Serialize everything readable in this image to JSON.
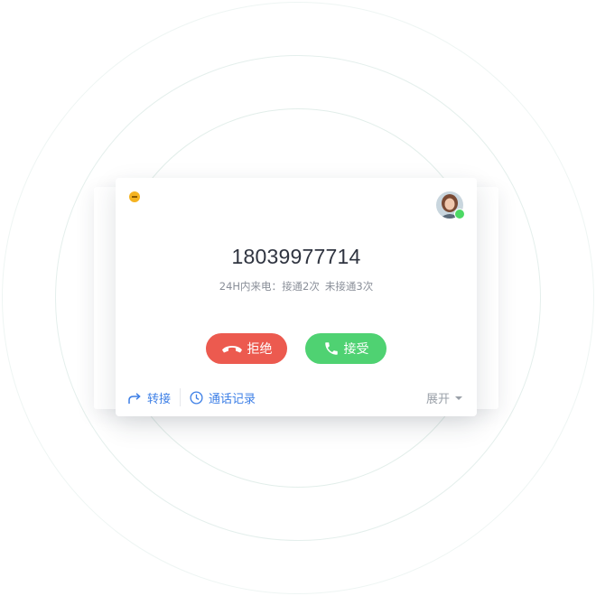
{
  "caller": {
    "number": "18039977714",
    "stats_prefix": "24H内来电：",
    "answered": "接通2次",
    "missed": "未接通3次"
  },
  "actions": {
    "reject_label": "拒绝",
    "accept_label": "接受"
  },
  "footer": {
    "transfer_label": "转接",
    "history_label": "通话记录",
    "expand_label": "展开"
  },
  "status": {
    "online": true
  },
  "colors": {
    "reject": "#ec5a4f",
    "accept": "#4fd272",
    "link": "#3d7fe6",
    "minimize": "#f5b321",
    "online": "#4cd964"
  },
  "icons": {
    "minimize": "minimize-icon",
    "avatar": "avatar",
    "reject": "hang-up-icon",
    "accept": "phone-icon",
    "transfer": "forward-arrow-icon",
    "history": "clock-icon",
    "expand": "caret-down-icon"
  }
}
